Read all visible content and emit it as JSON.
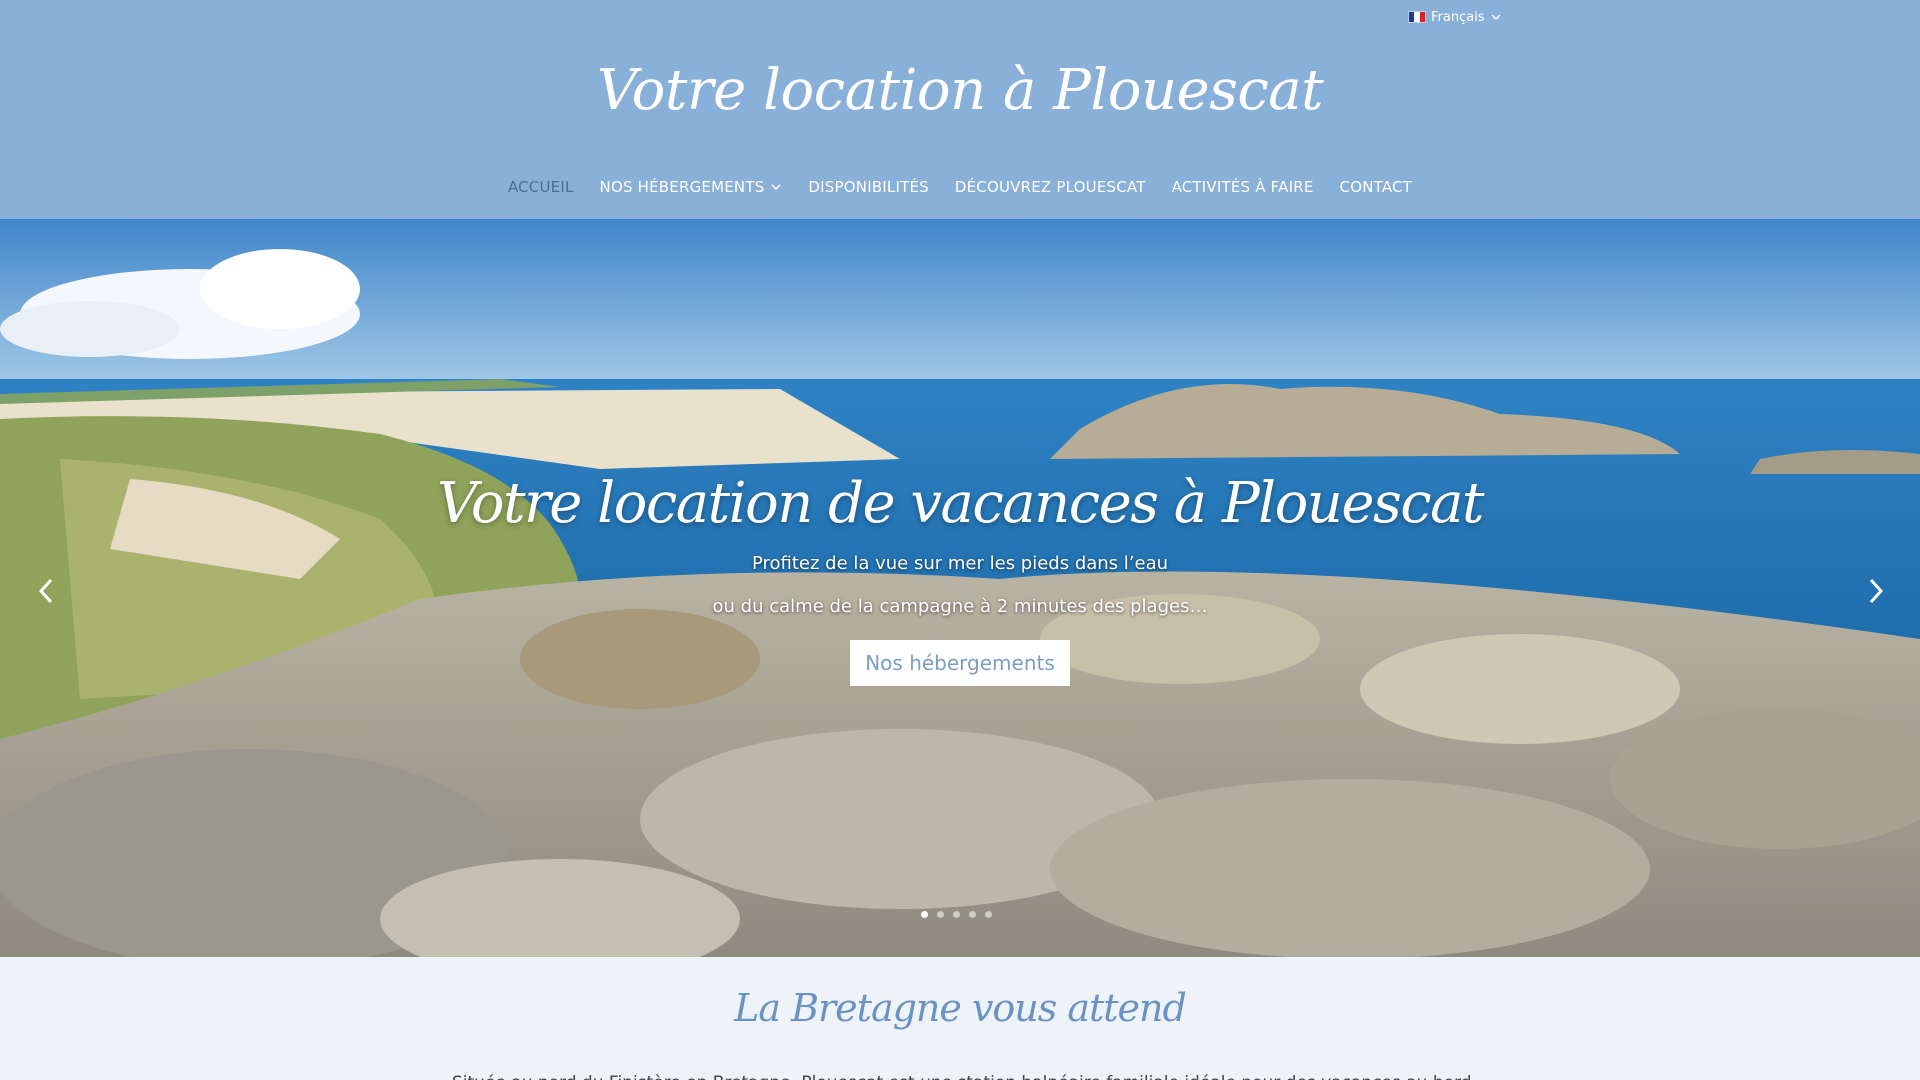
{
  "language": {
    "label": "Français",
    "flag_icon": "france-flag-icon"
  },
  "header": {
    "site_title": "Votre location à Plouescat",
    "background": "#89b0d8"
  },
  "nav": {
    "items": [
      {
        "label": "ACCUEIL",
        "active": true
      },
      {
        "label": "NOS HÉBERGEMENTS",
        "dropdown": true
      },
      {
        "label": "DISPONIBILITÉS"
      },
      {
        "label": "DÉCOUVREZ PLOUESCAT"
      },
      {
        "label": "ACTIVITÉS À FAIRE"
      },
      {
        "label": "CONTACT"
      }
    ]
  },
  "hero": {
    "title": "Votre location de vacances à Plouescat",
    "line1": "Profitez de la vue sur mer les pieds dans l’eau",
    "line2": "ou du calme de la campagne à 2 minutes des plages…",
    "button_label": "Nos hébergements",
    "slide_count": 5,
    "active_slide": 1
  },
  "section": {
    "title": "La Bretagne vous attend",
    "intro_partial": "Située au nord du Finistère en Bretagne, Plouescat est une station balnéaire familiale idéale pour des vacances au bord de la mer."
  },
  "colors": {
    "accent": "#6a93c3",
    "active_nav": "#4a6e96"
  }
}
